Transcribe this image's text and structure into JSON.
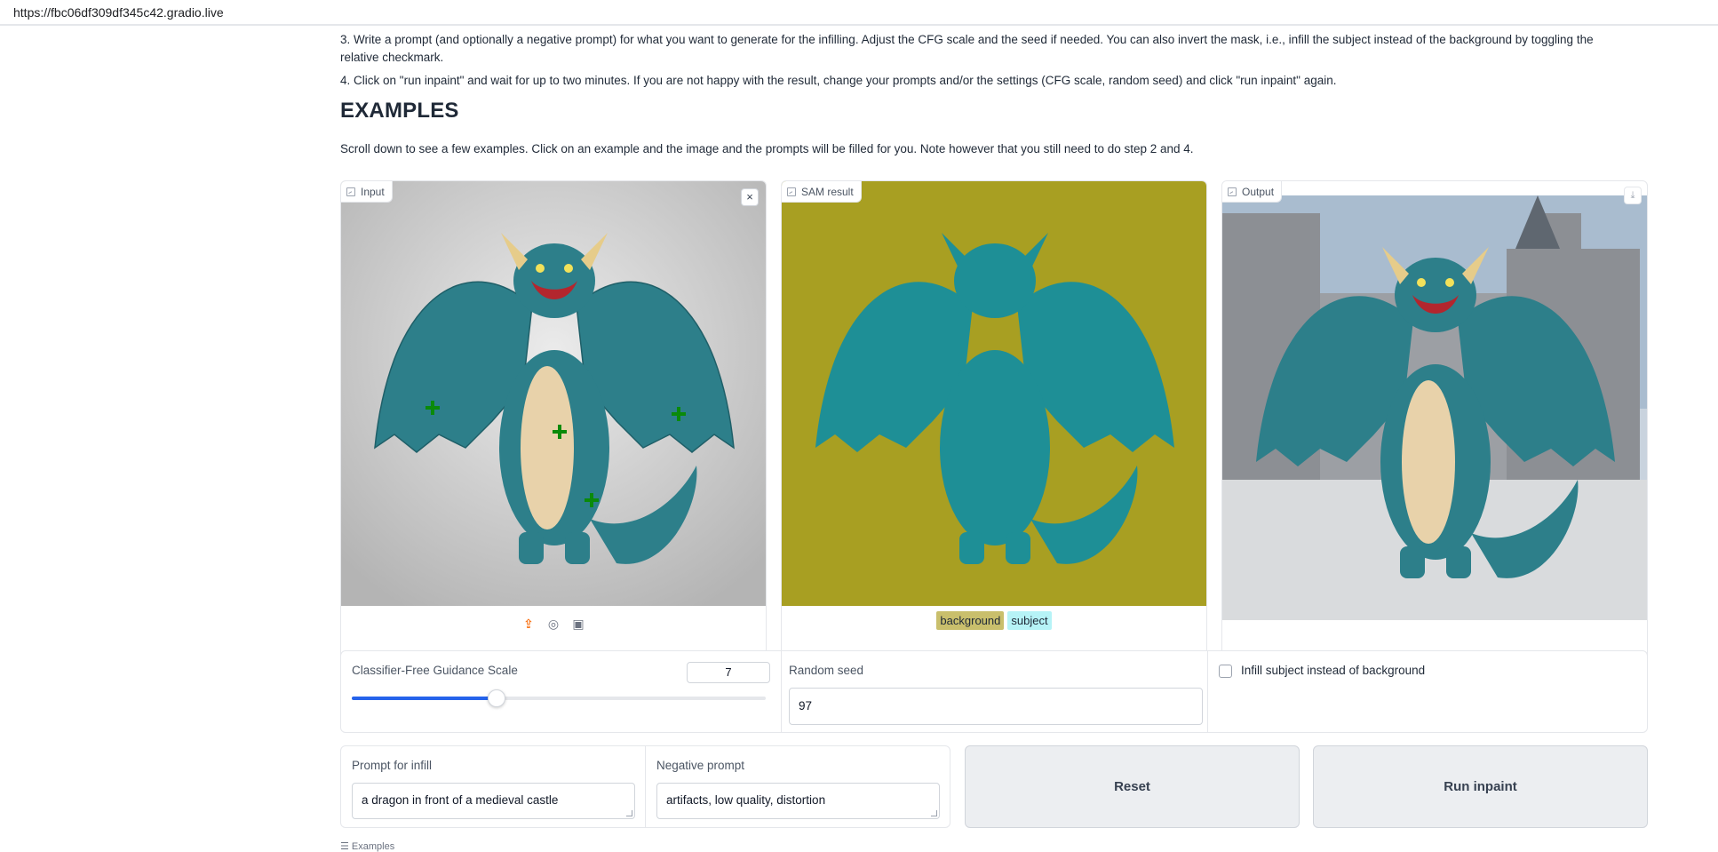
{
  "browser": {
    "url": "https://fbc06df309df345c42.gradio.live"
  },
  "instructions": {
    "step3": "3. Write a prompt (and optionally a negative prompt) for what you want to generate for the infilling. Adjust the CFG scale and the seed if needed. You can also invert the mask, i.e., infill the subject instead of the background by toggling the relative checkmark.",
    "step4": "4. Click on \"run inpaint\" and wait for up to two minutes. If you are not happy with the result, change your prompts and/or the settings (CFG scale, random seed) and click \"run inpaint\" again."
  },
  "examples_section": {
    "heading": "EXAMPLES",
    "intro": "Scroll down to see a few examples. Click on an example and the image and the prompts will be filled for you. Note however that you still need to do step 2 and 4."
  },
  "panels": {
    "input": {
      "label": "Input",
      "close": "×"
    },
    "sam": {
      "label": "SAM result",
      "legend": [
        "background",
        "subject"
      ]
    },
    "output": {
      "label": "Output",
      "download": "⤓"
    }
  },
  "controls": {
    "cfg": {
      "label": "Classifier-Free Guidance Scale",
      "value": "7",
      "slider_fraction": 0.35
    },
    "seed": {
      "label": "Random seed",
      "value": "97"
    },
    "invert": {
      "label": "Infill subject instead of background",
      "checked": false
    }
  },
  "prompts": {
    "prompt": {
      "label": "Prompt for infill",
      "value": "a dragon in front of a medieval castle"
    },
    "negative": {
      "label": "Negative prompt",
      "value": "artifacts, low quality, distortion"
    }
  },
  "buttons": {
    "reset": "Reset",
    "run": "Run inpaint"
  },
  "footer": {
    "examples": "☰ Examples"
  },
  "colors": {
    "accent": "#2563eb",
    "sam_background": "#a89f22",
    "sam_subject": "#1e8f96",
    "dragon_body": "#2d7f8a",
    "dragon_belly": "#e8d2aa",
    "point_marker": "#0a8a0a"
  }
}
